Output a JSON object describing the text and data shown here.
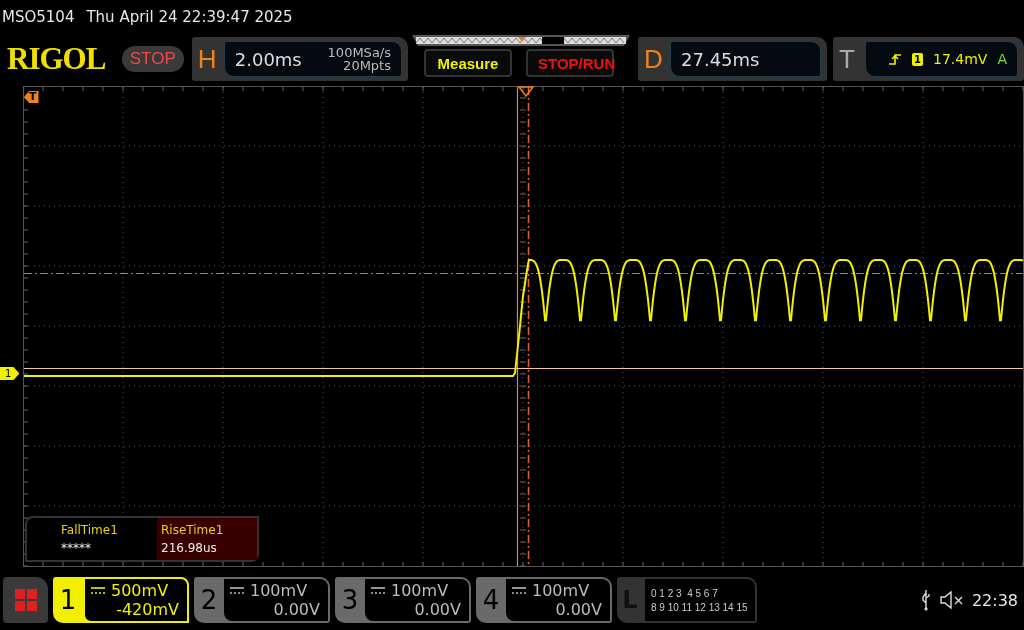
{
  "status_line": {
    "model": "MSO5104",
    "datetime": "Thu April 24 22:39:47 2025"
  },
  "header": {
    "logo": "RIGOL",
    "run_state": "STOP",
    "horizontal": {
      "label": "H",
      "timebase": "2.00ms",
      "sample_rate": "100MSa/s",
      "memory_depth": "20Mpts"
    },
    "measure_button": "Measure",
    "stop_run_button": "STOP/RUN",
    "delay": {
      "label": "D",
      "value": "27.45ms"
    },
    "trigger": {
      "label": "T",
      "source": "1",
      "trigger_level": "17.4mV",
      "mode": "A"
    }
  },
  "plot": {
    "trigger_marker": "T",
    "channel_marker": "1"
  },
  "measurements": [
    {
      "name": "FallTime1",
      "value": "*****",
      "selected": false
    },
    {
      "name": "RiseTime1",
      "value": "216.98us",
      "selected": true
    }
  ],
  "channels": [
    {
      "number": "1",
      "scale": "500mV",
      "offset": "-420mV",
      "active": true
    },
    {
      "number": "2",
      "scale": "100mV",
      "offset": "0.00V",
      "active": false
    },
    {
      "number": "3",
      "scale": "100mV",
      "offset": "0.00V",
      "active": false
    },
    {
      "number": "4",
      "scale": "100mV",
      "offset": "0.00V",
      "active": false
    }
  ],
  "logic": {
    "label": "L",
    "rows": [
      "0 1 2 3  4 5 6 7",
      "8 9 10 11 12 13 14 15"
    ]
  },
  "status_bar": {
    "clock": "22:38"
  }
}
